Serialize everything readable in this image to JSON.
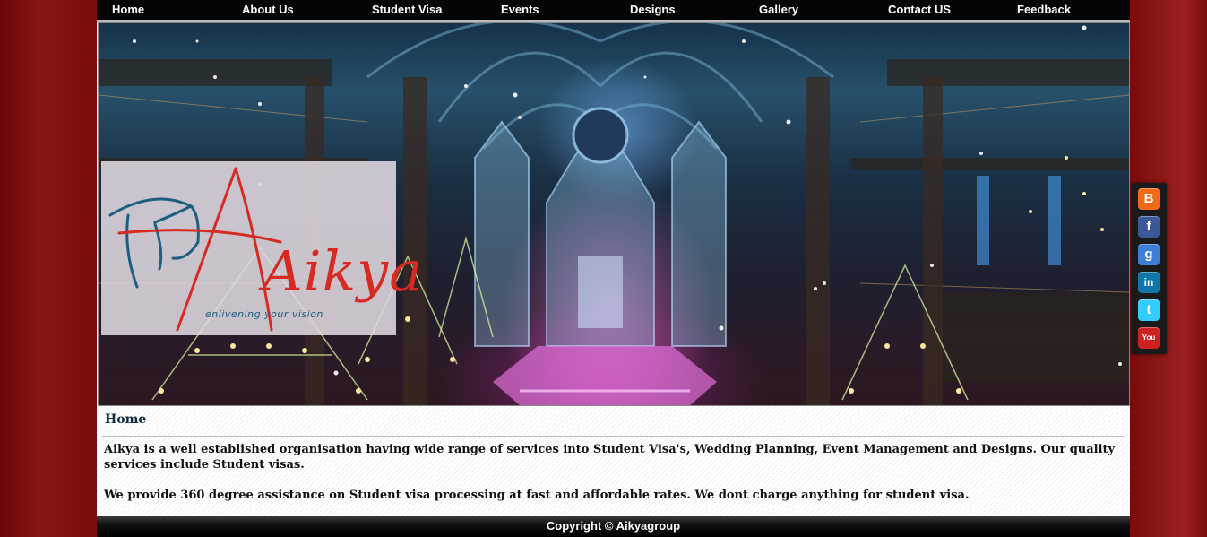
{
  "nav": {
    "items": [
      "Home",
      "About Us",
      "Student Visa",
      "Events",
      "Designs",
      "Gallery",
      "Contact US",
      "Feedback"
    ]
  },
  "logo": {
    "wordmark": "Aikya",
    "tagline": "enlivening your vision"
  },
  "content": {
    "heading": "Home",
    "paragraph_1": "Aikya is a well established organisation having wide range of services into Student Visa's, Wedding Planning, Event Management and Designs. Our quality services include Student visas.",
    "paragraph_2": "We provide 360 degree assistance on Student visa processing at fast and affordable rates.  We dont charge anything for student visa."
  },
  "footer": {
    "copyright": "Copyright © Aikyagroup"
  },
  "social": {
    "icons": [
      "blogger-icon",
      "facebook-icon",
      "google-icon",
      "linkedin-icon",
      "twitter-icon",
      "youtube-icon"
    ],
    "glyphs": [
      "B",
      "f",
      "g",
      "in",
      "t",
      "You"
    ]
  },
  "colors": {
    "nav_bg": "#050505",
    "page_bg_red": "#7d0e0e",
    "logo_red": "#d62a22",
    "logo_blue": "#1d5f80",
    "heading": "#0d2a3f"
  }
}
